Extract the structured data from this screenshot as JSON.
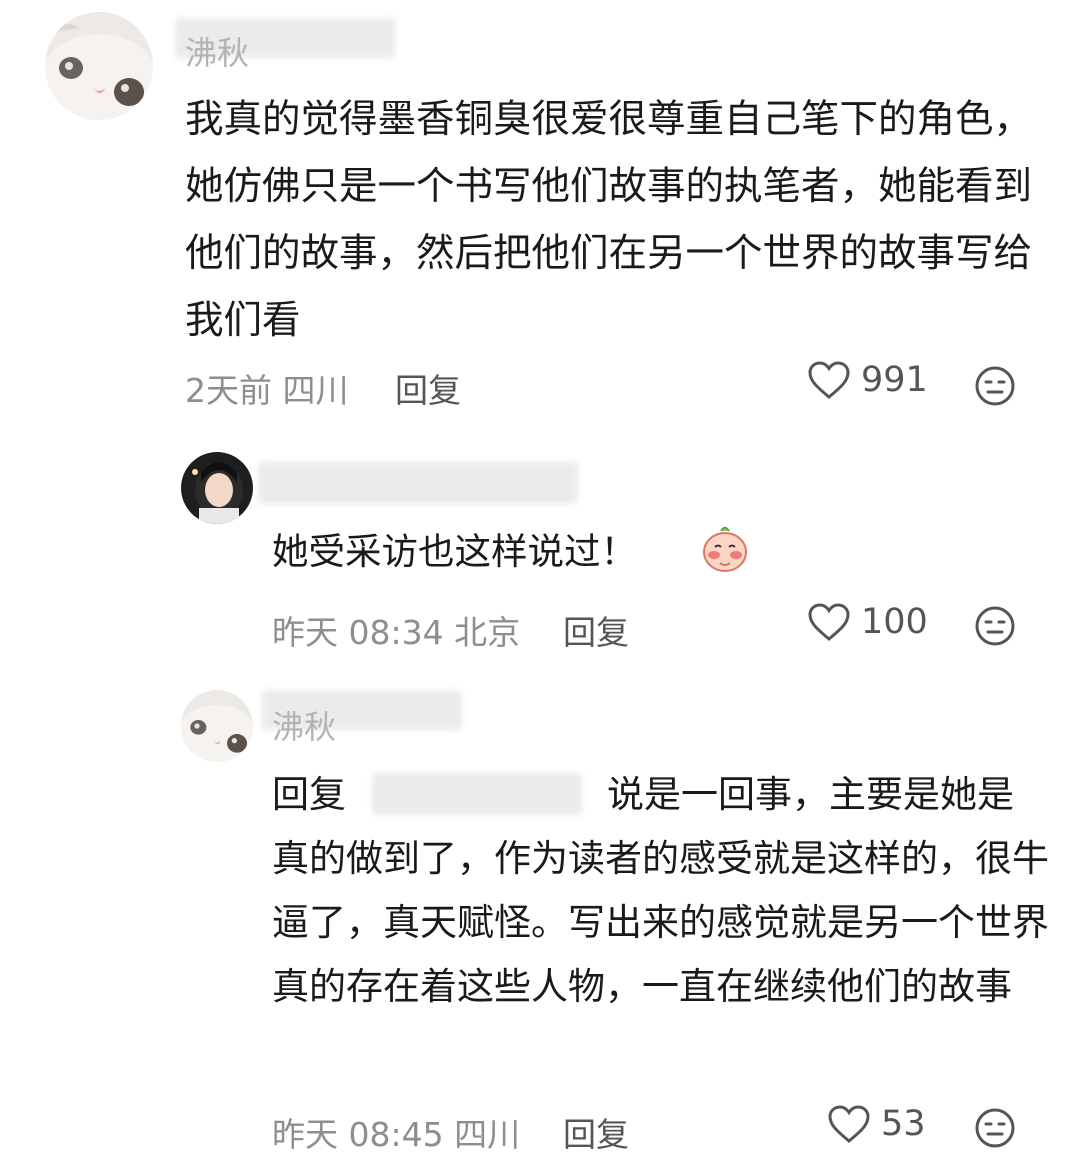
{
  "comments": [
    {
      "username": "沸秋",
      "text": "我真的觉得墨香铜臭很爱很尊重自己笔下的角色，她仿佛只是一个书写他们故事的执笔者，她能看到他们的故事，然后把他们在另一个世界的故事写给我们看",
      "time": "2天前",
      "location": "四川",
      "reply_label": "回复",
      "likes": "991"
    },
    {
      "username": "",
      "text": "她受采访也这样说过！",
      "time": "昨天 08:34",
      "location": "北京",
      "reply_label": "回复",
      "likes": "100"
    },
    {
      "username": "沸秋",
      "reply_prefix": "回复",
      "text": "说是一回事，主要是她是真的做到了，作为读者的感受就是这样的，很牛逼了，真天赋怪。写出来的感觉就是另一个世界真的存在着这些人物，一直在继续他们的故事",
      "time": "昨天 08:45",
      "location": "四川",
      "reply_label": "回复",
      "likes": "53"
    }
  ],
  "icons": {
    "like": "heart-outline-icon",
    "dislike": "neutral-face-icon",
    "emoji": "blushing-face-sticker"
  },
  "colors": {
    "text": "#1a1a1a",
    "meta": "#8e8e8e",
    "username": "#b3b3b3"
  }
}
